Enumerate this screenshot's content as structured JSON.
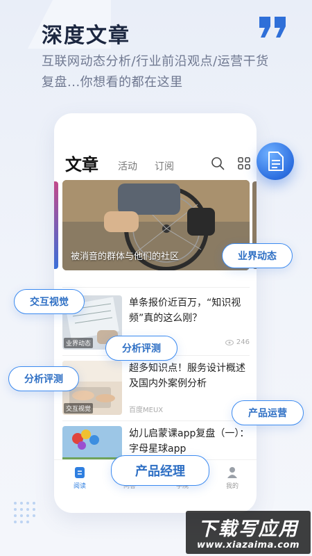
{
  "hero": {
    "title": "深度文章",
    "subtitle": "互联网动态分析/行业前沿观点/运营干货复盘...你想看的都在这里"
  },
  "app": {
    "tabs": [
      "文章",
      "活动",
      "订阅"
    ],
    "banner": {
      "caption": "被消音的群体与他们的社区"
    },
    "articles": [
      {
        "title": "单条报价近百万，“知识视频”真的这么刚？",
        "tag": "业界动态",
        "source": "",
        "views": "246"
      },
      {
        "title": "超多知识点！服务设计概述及国内外案例分析",
        "tag": "交互视觉",
        "source": "百度MEUX",
        "views": ""
      },
      {
        "title": "幼儿启蒙课app复盘（一）：字母星球app",
        "tag": "",
        "source": "",
        "views": ""
      }
    ],
    "bottom_nav": [
      {
        "label": "阅读",
        "icon": "read-icon",
        "active": true
      },
      {
        "label": "问答",
        "icon": "qa-icon",
        "active": false
      },
      {
        "label": "学院",
        "icon": "academy-icon",
        "active": false
      },
      {
        "label": "我的",
        "icon": "profile-icon",
        "active": false
      }
    ]
  },
  "floating_tags": {
    "industry": "业界动态",
    "interaction": "交互视觉",
    "analysis_1": "分析评测",
    "analysis_2": "分析评测",
    "operation": "产品运营",
    "product": "产品经理"
  },
  "watermark": {
    "title": "下载写应用",
    "url": "www.xiazaima.com"
  },
  "colors": {
    "accent": "#2f7fe0",
    "pill_border": "#3b8af0",
    "title": "#1c2740"
  }
}
